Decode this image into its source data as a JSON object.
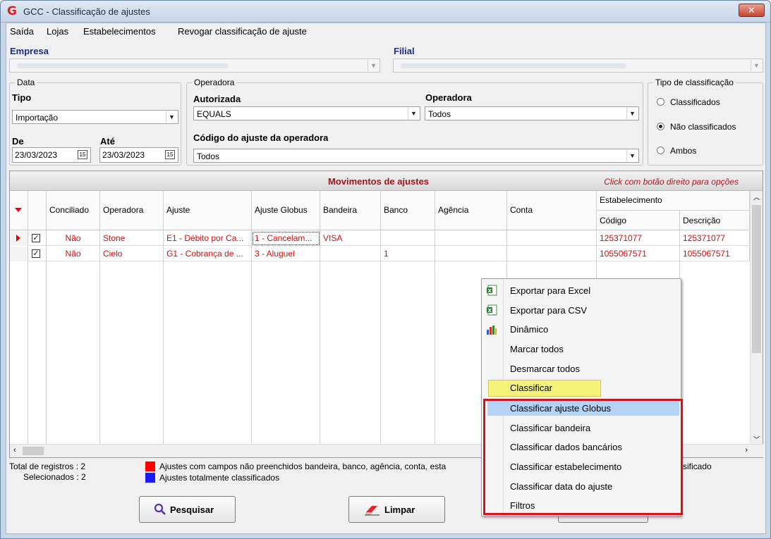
{
  "window": {
    "title": "GCC - Classificação de ajustes",
    "close_symbol": "✕"
  },
  "menu": {
    "saida": "Saída",
    "lojas": "Lojas",
    "estabelecimentos": "Estabelecimentos",
    "revogar": "Revogar classificação de ajuste"
  },
  "empresa": {
    "label": "Empresa"
  },
  "filial": {
    "label": "Filial"
  },
  "data_group": {
    "title": "Data",
    "tipo_label": "Tipo",
    "tipo_value": "Importação",
    "de_label": "De",
    "ate_label": "Até",
    "de_value": "23/03/2023",
    "ate_value": "23/03/2023",
    "cal_icon_text": "15"
  },
  "operadora_group": {
    "title": "Operadora",
    "autorizada_label": "Autorizada",
    "autorizada_value": "EQUALS",
    "operadora_label": "Operadora",
    "operadora_value": "Todos",
    "codigo_label": "Código do ajuste da operadora",
    "codigo_value": "Todos"
  },
  "tipo_classificacao": {
    "title": "Tipo de classificação",
    "options": [
      "Classificados",
      "Não classificados",
      "Ambos"
    ],
    "selected": "Não classificados"
  },
  "grid": {
    "title": "Movimentos de ajustes",
    "hint": "Click com botão direito para opções",
    "columns": {
      "conciliado": "Conciliado",
      "operadora": "Operadora",
      "ajuste": "Ajuste",
      "ajuste_globus": "Ajuste Globus",
      "bandeira": "Bandeira",
      "banco": "Banco",
      "agencia": "Agência",
      "conta": "Conta",
      "estabelecimento": "Estabelecimento",
      "codigo": "Código",
      "descricao": "Descrição"
    },
    "rows": [
      {
        "conciliado": "Não",
        "operadora": "Stone",
        "ajuste": "E1 - Débito por Ca...",
        "ajuste_globus": "1 - Cancelam...",
        "bandeira": "VISA",
        "banco": "",
        "agencia": "",
        "conta": "",
        "codigo": "125371077",
        "descricao": "125371077"
      },
      {
        "conciliado": "Não",
        "operadora": "Cielo",
        "ajuste": "G1 - Cobrança de ...",
        "ajuste_globus": "3 - Aluguel",
        "bandeira": "",
        "banco": "1",
        "agencia": "",
        "conta": "",
        "codigo": "1055067571",
        "descricao": "1055067571"
      }
    ]
  },
  "footer": {
    "total_label": "Total de registros : 2",
    "selecionados_label": "Selecionados : 2",
    "legend_red": "Ajustes com campos não preenchidos bandeira, banco, agência, conta, esta",
    "legend_red_tail": "sificado",
    "legend_blue": "Ajustes totalmente classificados",
    "colors": {
      "red": "#ff0000",
      "blue": "#1a1aff"
    }
  },
  "buttons": {
    "pesquisar": "Pesquisar",
    "limpar": "Limpar"
  },
  "context_menu": {
    "items": [
      "Exportar para Excel",
      "Exportar para CSV",
      "Dinâmico",
      "Marcar todos",
      "Desmarcar todos",
      "Classificar",
      "Classificar ajuste Globus",
      "Classificar bandeira",
      "Classificar dados bancários",
      "Classificar estabelecimento",
      "Classificar data do ajuste",
      "Filtros"
    ],
    "highlight_color": "#f5f37a",
    "hover_color": "#b5d3f5",
    "annotation_color": "#d0151c"
  }
}
